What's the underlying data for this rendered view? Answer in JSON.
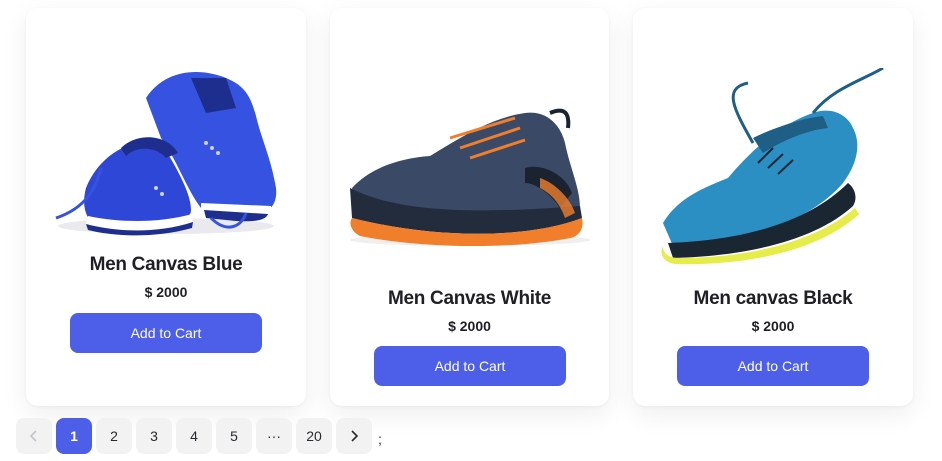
{
  "products": [
    {
      "name": "Men Canvas Blue",
      "price": "$ 2000",
      "button": "Add to Cart",
      "image": "blue-running-shoes"
    },
    {
      "name": "Men Canvas White",
      "price": "$ 2000",
      "button": "Add to Cart",
      "image": "navy-orange-hiking-shoe"
    },
    {
      "name": "Men canvas Black",
      "price": "$ 2000",
      "button": "Add to Cart",
      "image": "teal-yellow-trail-shoe"
    }
  ],
  "pagination": {
    "prev_icon": "chevron-left-icon",
    "pages": [
      "1",
      "2",
      "3",
      "4",
      "5",
      "···",
      "20"
    ],
    "current": "1",
    "next_icon": "chevron-right-icon",
    "trailing_text": ";"
  },
  "colors": {
    "accent": "#4d5fe8",
    "card_bg": "#ffffff",
    "pager_bg": "#f2f2f3"
  }
}
